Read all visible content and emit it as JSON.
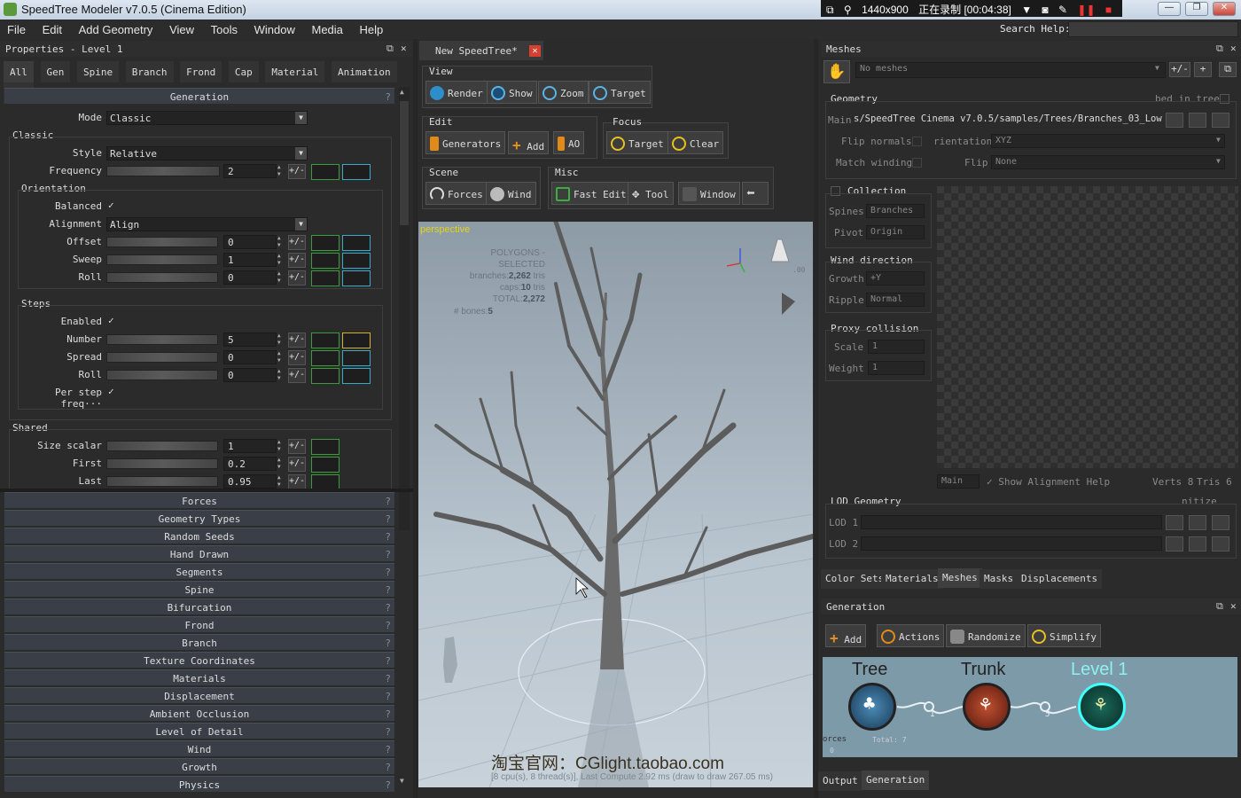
{
  "window": {
    "title": "SpeedTree Modeler v7.0.5 (Cinema Edition)",
    "minimize": "—",
    "maximize": "❐",
    "close": "✕"
  },
  "recorder": {
    "resolution": "1440x900",
    "status": "正在录制 [00:04:38]"
  },
  "menu": {
    "items": [
      "File",
      "Edit",
      "Add Geometry",
      "View",
      "Tools",
      "Window",
      "Media",
      "Help"
    ],
    "search_label": "Search Help:"
  },
  "properties": {
    "header": "Properties - Level 1",
    "tabs": [
      "All",
      "Gen",
      "Spine",
      "Branch",
      "Frond",
      "Cap",
      "Material",
      "Animation",
      "LOD"
    ],
    "generation_header": "Generation",
    "mode_label": "Mode",
    "mode_value": "Classic",
    "classic_group": "Classic",
    "style_label": "Style",
    "style_value": "Relative",
    "frequency_label": "Frequency",
    "frequency_value": "2",
    "orientation_group": "Orientation",
    "balanced_label": "Balanced",
    "alignment_label": "Alignment",
    "alignment_value": "Align",
    "offset_label": "Offset",
    "offset_value": "0",
    "sweep_label": "Sweep",
    "sweep_value": "1",
    "roll_label": "Roll",
    "roll_value": "0",
    "steps_group": "Steps",
    "enabled_label": "Enabled",
    "number_label": "Number",
    "number_value": "5",
    "spread_label": "Spread",
    "spread_value": "0",
    "steps_roll_label": "Roll",
    "steps_roll_value": "0",
    "per_step_label": "Per step freq···",
    "shared_group": "Shared",
    "size_scalar_label": "Size scalar",
    "size_scalar_value": "1",
    "first_label": "First",
    "first_value": "0.2",
    "last_label": "Last",
    "last_value": "0.95",
    "plusminus": "+/-",
    "check": "✓",
    "help": "?",
    "sections": [
      "Forces",
      "Geometry Types",
      "Random Seeds",
      "Hand Drawn",
      "Segments",
      "Spine",
      "Bifurcation",
      "Frond",
      "Branch",
      "Texture Coordinates",
      "Materials",
      "Displacement",
      "Ambient Occlusion",
      "Level of Detail",
      "Wind",
      "Growth",
      "Physics"
    ]
  },
  "document": {
    "tab": "New SpeedTree*",
    "view_group": "View",
    "view_buttons": [
      "Render",
      "Show",
      "Zoom",
      "Target"
    ],
    "edit_group": "Edit",
    "edit_buttons": [
      "Generators",
      "Add",
      "AO"
    ],
    "focus_group": "Focus",
    "focus_buttons": [
      "Target",
      "Clear"
    ],
    "scene_group": "Scene",
    "scene_buttons": [
      "Forces",
      "Wind"
    ],
    "misc_group": "Misc",
    "misc_buttons": [
      "Fast Edit",
      "Tool",
      "Window"
    ]
  },
  "viewport": {
    "camera": "perspective",
    "stats_title": "POLYGONS - SELECTED",
    "branches_label": "branches:",
    "branches_value": "2,262",
    "caps_label": "caps:",
    "caps_value": "10",
    "total_label": "TOTAL:",
    "total_value": "2,272",
    "tris": "tris",
    "bones_label": "# bones:",
    "bones_value": "5",
    "watermark": "淘宝官网：CGlight.taobao.com",
    "footer": "[8 cpu(s), 8 thread(s)], Last Compute 2.92 ms (draw to draw 267.05 ms)",
    "gizmo_value": ".00"
  },
  "meshes": {
    "header": "Meshes",
    "no_meshes": "No meshes",
    "geometry_group": "Geometry",
    "bed_in_tree": "bed in tree",
    "main_label": "Main",
    "main_path": "s/SpeedTree Cinema v7.0.5/samples/Trees/Branches_03_Low.stm",
    "flip_normals": "Flip normals",
    "orientation_label": "rientation",
    "orientation_value": "XYZ",
    "match_winding": "Match winding",
    "flip_label": "Flip",
    "flip_value": "None",
    "collection_group": "Collection",
    "spines_label": "Spines",
    "spines_value": "Branches",
    "pivot_label": "Pivot",
    "pivot_value": "Origin",
    "wind_direction_group": "Wind direction",
    "growth_label": "Growth",
    "growth_value": "+Y",
    "ripple_label": "Ripple",
    "ripple_value": "Normal",
    "proxy_group": "Proxy collision",
    "scale_label": "Scale",
    "scale_value": "1",
    "weight_label": "Weight",
    "weight_value": "1",
    "main_dropdown": "Main",
    "show_alignment": "Show Alignment Help",
    "verts": "Verts 8",
    "tris": "Tris 6",
    "lod_group": "LOD Geometry",
    "lod_suffix": "nitize",
    "lod1": "LOD 1",
    "lod2": "LOD 2",
    "bottom_tabs": [
      "Color Sets",
      "Materials",
      "Meshes",
      "Masks",
      "Displacements"
    ]
  },
  "generation": {
    "header": "Generation",
    "buttons": [
      "Add",
      "Actions",
      "Randomize",
      "Simplify"
    ],
    "nodes": [
      "Tree",
      "Trunk",
      "Level 1"
    ],
    "link1": "1",
    "link2": "5",
    "forces_label": "orces",
    "forces_value": "0",
    "total_label": "Total: 7",
    "bottom_tabs": [
      "Output",
      "Generation"
    ]
  }
}
